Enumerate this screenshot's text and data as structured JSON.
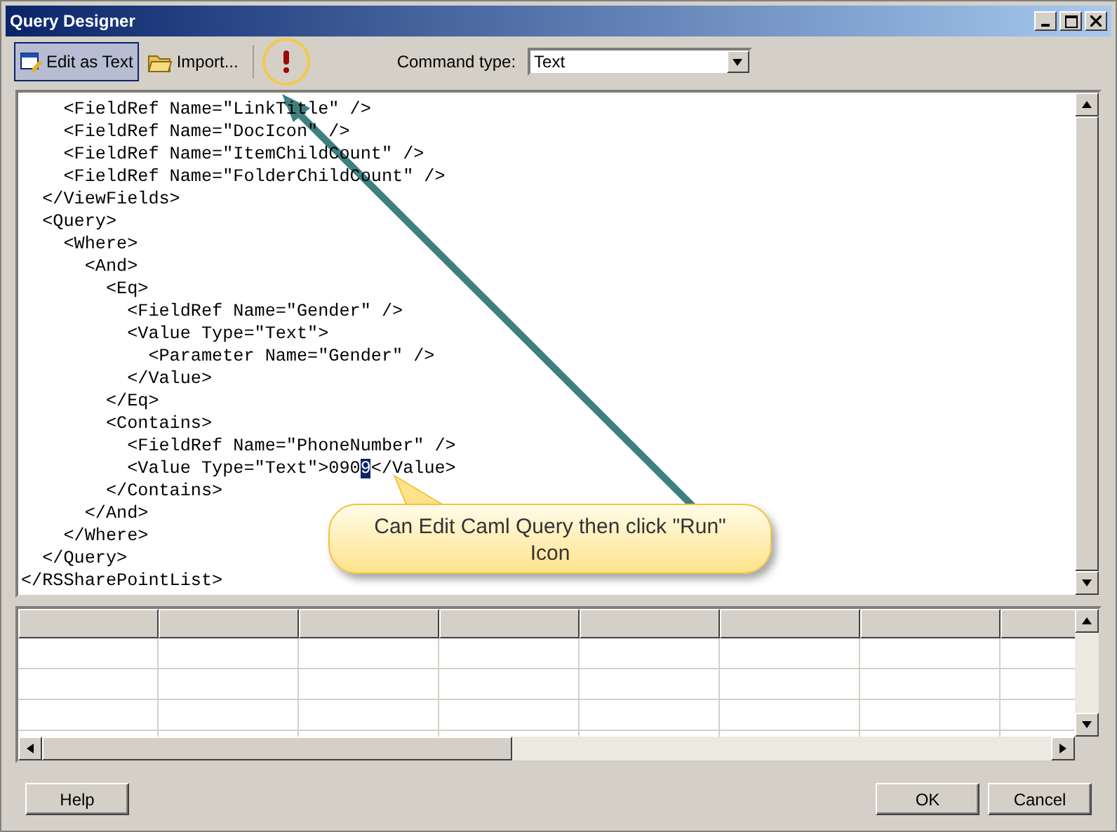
{
  "window": {
    "title": "Query Designer"
  },
  "toolbar": {
    "buttons": [
      {
        "label": "Edit as Text",
        "selected": true
      },
      {
        "label": "Import...",
        "selected": false
      }
    ],
    "command_type": {
      "label": "Command type:",
      "value": "Text"
    }
  },
  "editor": {
    "lines": [
      {
        "kind": "plain",
        "text": "    <FieldRef Name=\"LinkTitle\" />"
      },
      {
        "kind": "plain",
        "text": "    <FieldRef Name=\"DocIcon\" />"
      },
      {
        "kind": "plain",
        "text": "    <FieldRef Name=\"ItemChildCount\" />"
      },
      {
        "kind": "plain",
        "text": "    <FieldRef Name=\"FolderChildCount\" />"
      },
      {
        "kind": "plain",
        "text": "  </ViewFields>"
      },
      {
        "kind": "plain",
        "text": "  <Query>"
      },
      {
        "kind": "plain",
        "text": "    <Where>"
      },
      {
        "kind": "plain",
        "text": "      <And>"
      },
      {
        "kind": "plain",
        "text": "        <Eq>"
      },
      {
        "kind": "plain",
        "text": "          <FieldRef Name=\"Gender\" />"
      },
      {
        "kind": "plain",
        "text": "          <Value Type=\"Text\">"
      },
      {
        "kind": "plain",
        "text": "            <Parameter Name=\"Gender\" />"
      },
      {
        "kind": "plain",
        "text": "          </Value>"
      },
      {
        "kind": "plain",
        "text": "        </Eq>"
      },
      {
        "kind": "plain",
        "text": "        <Contains>"
      },
      {
        "kind": "plain",
        "text": "          <FieldRef Name=\"PhoneNumber\" />"
      },
      {
        "kind": "selection",
        "before": "          <Value Type=\"Text\">090",
        "selected": "9",
        "after": "</Value>"
      },
      {
        "kind": "plain",
        "text": "        </Contains>"
      },
      {
        "kind": "plain",
        "text": "      </And>"
      },
      {
        "kind": "plain",
        "text": "    </Where>"
      },
      {
        "kind": "plain",
        "text": "  </Query>"
      },
      {
        "kind": "plain",
        "text": "</RSSharePointList>"
      }
    ]
  },
  "callout": {
    "text": "Can Edit Caml Query then click \"Run\" Icon"
  },
  "buttons": {
    "left": [
      "Help"
    ],
    "right": [
      "OK",
      "Cancel"
    ]
  }
}
